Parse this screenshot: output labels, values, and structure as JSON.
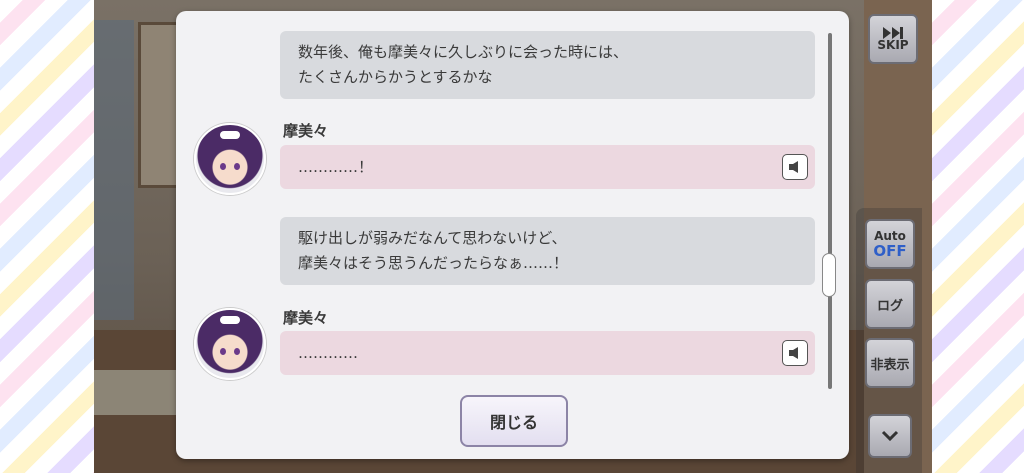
{
  "log": {
    "messages": [
      {
        "type": "narration",
        "text": "数年後、俺も摩美々に久しぶりに会った時には、\nたくさんからかうとするかな"
      },
      {
        "type": "character",
        "speaker": "摩美々",
        "text": "…………！"
      },
      {
        "type": "narration",
        "text": "駆け出しが弱みだなんて思わないけど、\n摩美々はそう思うんだったらなぁ……！"
      },
      {
        "type": "character",
        "speaker": "摩美々",
        "text": "…………"
      }
    ],
    "close_label": "閉じる"
  },
  "controls": {
    "skip_label": "SKIP",
    "auto_label": "Auto",
    "auto_state": "OFF",
    "log_label": "ログ",
    "hide_label": "非表示"
  },
  "colors": {
    "narration_bubble": "#d8dade",
    "character_bubble": "#ecd8e0",
    "accent_blue": "#2f5fc8"
  }
}
